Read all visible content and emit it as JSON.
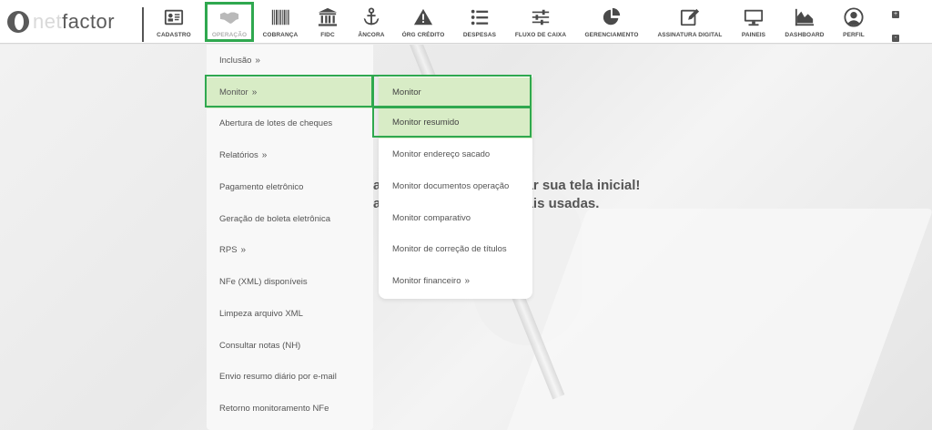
{
  "logo": {
    "part1": "net",
    "part2": "factor"
  },
  "nav": [
    {
      "key": "cadastro",
      "label": "CADASTRO",
      "icon": "id-card-icon"
    },
    {
      "key": "operacao",
      "label": "OPERAÇÃO",
      "icon": "handshake-icon",
      "active": true
    },
    {
      "key": "cobranca",
      "label": "COBRANÇA",
      "icon": "barcode-icon"
    },
    {
      "key": "fidc",
      "label": "FIDC",
      "icon": "bank-icon"
    },
    {
      "key": "ancora",
      "label": "ÂNCORA",
      "icon": "anchor-icon"
    },
    {
      "key": "orc_credito",
      "label": "ÓRG CRÉDITO",
      "icon": "warning-icon"
    },
    {
      "key": "despesas",
      "label": "DESPESAS",
      "icon": "list-icon"
    },
    {
      "key": "fluxo_caixa",
      "label": "FLUXO DE CAIXA",
      "icon": "sliders-icon"
    },
    {
      "key": "gerenciamento",
      "label": "GERENCIAMENTO",
      "icon": "pie-chart-icon"
    },
    {
      "key": "assinatura",
      "label": "ASSINATURA DIGITAL",
      "icon": "edit-icon"
    },
    {
      "key": "paineis",
      "label": "PAINEIS",
      "icon": "monitor-icon"
    },
    {
      "key": "dashboard",
      "label": "DASHBOARD",
      "icon": "area-chart-icon"
    },
    {
      "key": "perfil",
      "label": "PERFIL",
      "icon": "user-circle-icon"
    }
  ],
  "mini_buttons": [
    "+",
    "-"
  ],
  "welcome_line1": "a                            onalizar sua tela inicial!",
  "welcome_line2": "a                              as mais usadas.",
  "operacao_menu": [
    {
      "label": "Inclusão",
      "has_sub": true
    },
    {
      "label": "Monitor",
      "has_sub": true,
      "selected": true
    },
    {
      "label": "Abertura de lotes de cheques"
    },
    {
      "label": "Relatórios",
      "has_sub": true
    },
    {
      "label": "Pagamento eletrônico"
    },
    {
      "label": "Geração de boleta eletrônica"
    },
    {
      "label": "RPS",
      "has_sub": true
    },
    {
      "label": "NFe (XML) disponíveis"
    },
    {
      "label": "Limpeza arquivo XML"
    },
    {
      "label": "Consultar notas (NH)"
    },
    {
      "label": "Envio resumo diário por e-mail"
    },
    {
      "label": "Retorno monitoramento NFe"
    }
  ],
  "monitor_submenu": [
    {
      "label": "Monitor",
      "selected": true
    },
    {
      "label": "Monitor resumido",
      "selected": true
    },
    {
      "label": "Monitor endereço sacado"
    },
    {
      "label": "Monitor documentos operação"
    },
    {
      "label": "Monitor comparativo"
    },
    {
      "label": "Monitor de correção de títulos"
    },
    {
      "label": "Monitor financeiro",
      "has_sub": true
    }
  ],
  "submenu_chevron": "»",
  "colors": {
    "highlight": "#2fa84f",
    "selected_bg": "#d8ecc6",
    "text": "#555555"
  }
}
